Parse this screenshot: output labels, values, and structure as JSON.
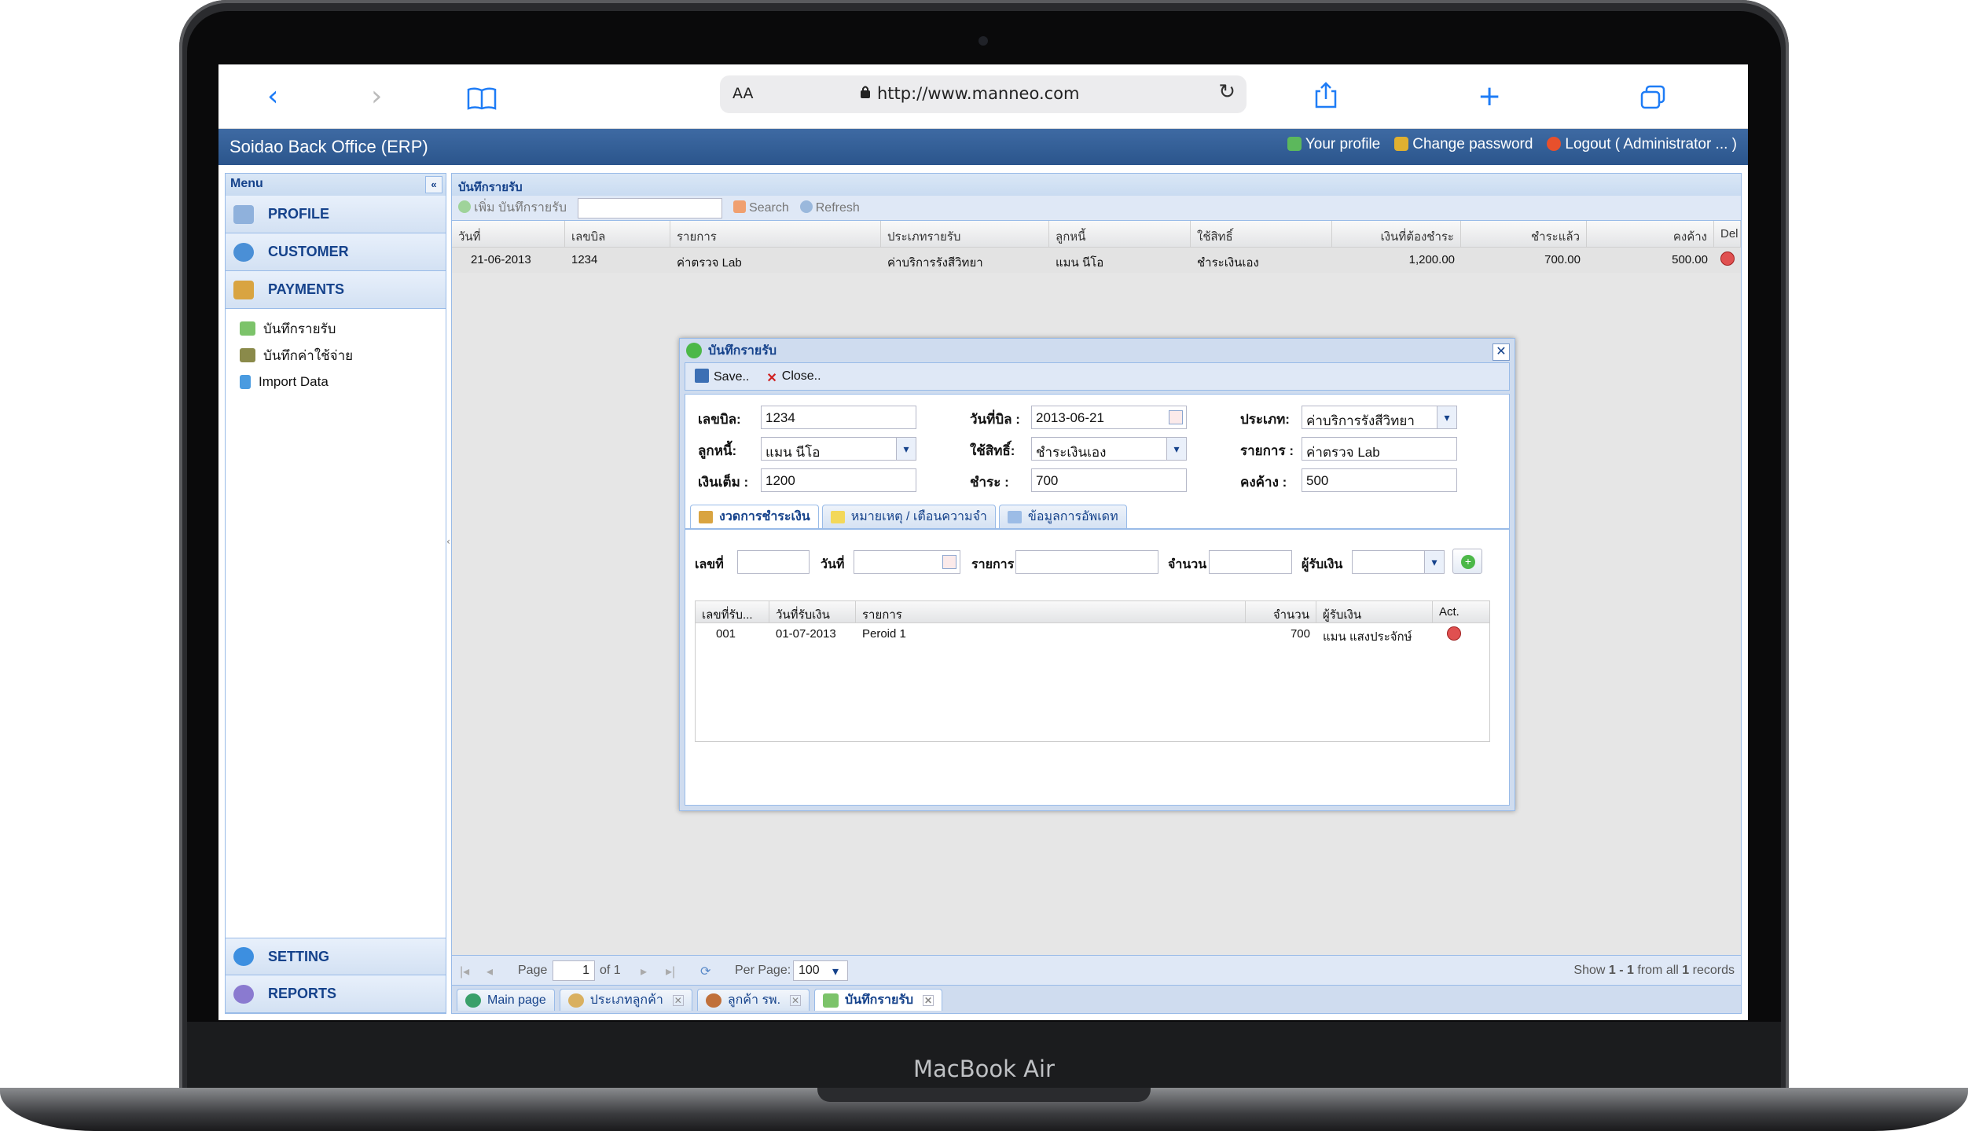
{
  "device": {
    "brand_label": "MacBook Air"
  },
  "browser": {
    "aa_label": "AA",
    "url": "http://www.manneo.com"
  },
  "app": {
    "title": "Soidao Back Office (ERP)",
    "links": {
      "profile": "Your profile",
      "change_password": "Change password",
      "logout": "Logout ( Administrator ... )"
    }
  },
  "sidebar": {
    "header": "Menu",
    "collapse_glyph": "«",
    "sections": [
      "PROFILE",
      "CUSTOMER",
      "PAYMENTS"
    ],
    "payments_items": [
      "บันทึกรายรับ",
      "บันทึกค่าใช้จ่าย",
      "Import Data"
    ],
    "bottom_sections": [
      "SETTING",
      "REPORTS"
    ]
  },
  "panel": {
    "title": "บันทึกรายรับ",
    "toolbar": {
      "add": "เพิ่ม บันทึกรายรับ",
      "search": "Search",
      "refresh": "Refresh"
    },
    "grid": {
      "columns": [
        "วันที่",
        "เลขบิล",
        "รายการ",
        "ประเภทรายรับ",
        "ลูกหนี้",
        "ใช้สิทธิ์",
        "เงินที่ต้องชำระ",
        "ชำระแล้ว",
        "คงค้าง",
        "Del"
      ],
      "rows": [
        {
          "date": "21-06-2013",
          "bill": "1234",
          "item": "ค่าตรวจ Lab",
          "type": "ค่าบริการรังสีวิทยา",
          "debtor": "แมน นีโอ",
          "right": "ชำระเงินเอง",
          "due": "1,200.00",
          "paid": "700.00",
          "remain": "500.00"
        }
      ]
    },
    "pager": {
      "page_label": "Page",
      "page_value": "1",
      "of_label": "of 1",
      "per_page_label": "Per Page:",
      "per_page_value": "100",
      "show_prefix": "Show",
      "show_range": "1 - 1",
      "show_mid": "from all",
      "show_total": "1",
      "show_suffix": "records"
    }
  },
  "tabs": [
    "Main page",
    "ประเภทลูกค้า",
    "ลูกค้า รพ.",
    "บันทึกรายรับ"
  ],
  "dialog": {
    "title": "บันทึกรายรับ",
    "save_label": "Save..",
    "close_label": "Close..",
    "close_glyph": "✕",
    "fields": {
      "bill_label": "เลขบิล:",
      "bill_value": "1234",
      "date_label": "วันที่บิล :",
      "date_value": "2013-06-21",
      "type_label": "ประเภท:",
      "type_value": "ค่าบริการรังสีวิทยา",
      "debtor_label": "ลูกหนี้:",
      "debtor_value": "แมน นีโอ",
      "right_label": "ใช้สิทธิ์:",
      "right_value": "ชำระเงินเอง",
      "item_label": "รายการ :",
      "item_value": "ค่าตรวจ Lab",
      "full_label": "เงินเต็ม :",
      "full_value": "1200",
      "pay_label": "ชำระ :",
      "pay_value": "700",
      "remain_label": "คงค้าง :",
      "remain_value": "500"
    },
    "tabs": [
      "งวดการชำระเงิน",
      "หมายเหตุ / เตือนความจำ",
      "ข้อมูลการอัพเดท"
    ],
    "installment": {
      "no_label": "เลขที่",
      "date_label": "วันที่",
      "item_label": "รายการ",
      "amount_label": "จำนวน",
      "receiver_label": "ผู้รับเงิน",
      "add_glyph": "+",
      "columns": [
        "เลขที่รับ...",
        "วันที่รับเงิน",
        "รายการ",
        "จำนวน",
        "ผู้รับเงิน",
        "Act."
      ],
      "rows": [
        {
          "no": "001",
          "date": "01-07-2013",
          "item": "Peroid 1",
          "amount": "700",
          "receiver": "แมน แสงประจักษ์"
        }
      ]
    }
  },
  "colors": {
    "header_blue": "#2b558c",
    "panel_blue": "#dfe8f6",
    "border_blue": "#99bbe8",
    "title_blue": "#15428b"
  }
}
